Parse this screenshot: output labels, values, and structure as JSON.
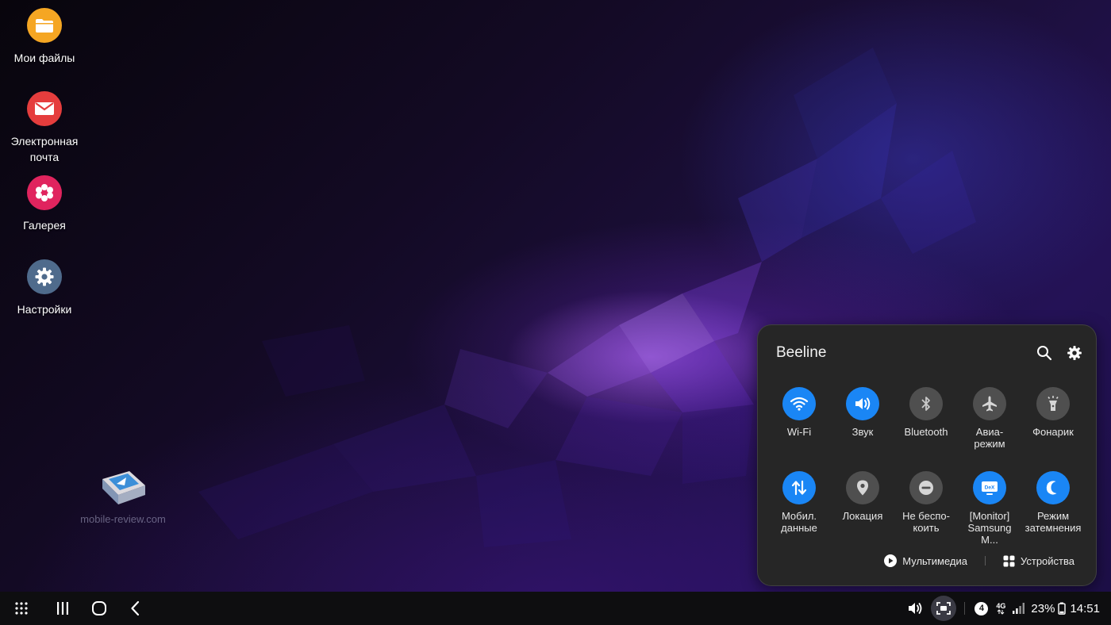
{
  "desktop": {
    "icons": [
      {
        "label": "Мои файлы",
        "icon": "folder-icon",
        "color": "#f5a623"
      },
      {
        "label": "Электронная почта",
        "icon": "mail-icon",
        "color": "#e53d3d"
      },
      {
        "label": "Галерея",
        "icon": "flower-icon",
        "color": "#e0245e"
      },
      {
        "label": "Настройки",
        "icon": "gear-icon",
        "color": "#4f6b8c"
      }
    ]
  },
  "watermark": {
    "text": "mobile-review.com"
  },
  "quick_panel": {
    "title": "Beeline",
    "actions": [
      {
        "name": "search-icon"
      },
      {
        "name": "settings-gear-icon"
      }
    ],
    "tiles": [
      {
        "label": "Wi-Fi",
        "state": "on",
        "icon": "wifi-icon"
      },
      {
        "label": "Звук",
        "state": "on",
        "icon": "sound-icon"
      },
      {
        "label": "Bluetooth",
        "state": "off",
        "icon": "bluetooth-icon"
      },
      {
        "label": "Авиа-\nрежим",
        "state": "off",
        "icon": "airplane-icon"
      },
      {
        "label": "Фонарик",
        "state": "off",
        "icon": "flashlight-icon"
      },
      {
        "label": "Мобил.\nданные",
        "state": "on",
        "icon": "mobile-data-icon"
      },
      {
        "label": "Локация",
        "state": "off",
        "icon": "location-icon"
      },
      {
        "label": "Не беспо-\nкоить",
        "state": "off",
        "icon": "do-not-disturb-icon"
      },
      {
        "label": "[Monitor]\nSamsung M...",
        "state": "on",
        "icon": "dex-monitor-icon"
      },
      {
        "label": "Режим\nзатемнения",
        "state": "on",
        "icon": "night-mode-icon"
      }
    ],
    "footer": {
      "media_label": "Мультимедиа",
      "devices_label": "Устройства"
    },
    "colors": {
      "active": "#1a86f5",
      "inactive": "#4f4f4f",
      "background": "#262626"
    }
  },
  "taskbar": {
    "buttons": [
      {
        "name": "apps-grid-icon"
      },
      {
        "name": "recents-icon"
      },
      {
        "name": "home-icon"
      },
      {
        "name": "back-icon"
      }
    ],
    "tray": {
      "notification_count": "4",
      "network_type": "4G",
      "battery": "23%",
      "time": "14:51"
    }
  }
}
